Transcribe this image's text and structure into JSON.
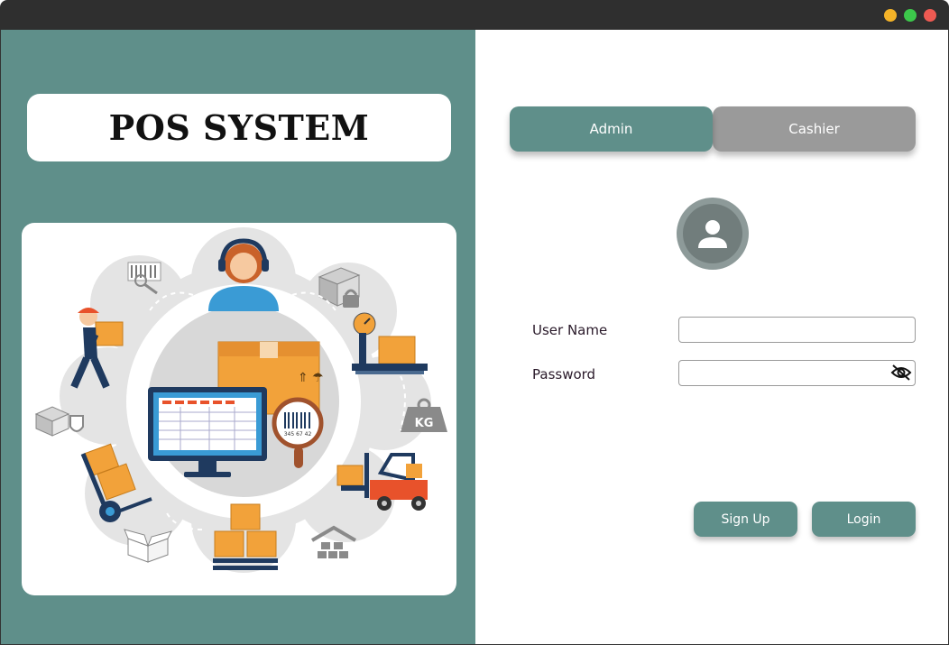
{
  "window": {
    "controls": [
      "minimize",
      "maximize",
      "close"
    ],
    "colors": {
      "minimize": "#f4b328",
      "maximize": "#3cc84b",
      "close": "#ee5a52"
    }
  },
  "left_panel": {
    "title": "POS SYSTEM",
    "illustration": {
      "icons": [
        "agent-headset",
        "barcode-scan",
        "locked-box",
        "weighing-scale",
        "weight-kg",
        "forklift",
        "warehouse",
        "pallet-boxes",
        "open-box",
        "hand-truck",
        "shield-box",
        "delivery-worker",
        "pos-monitor",
        "barcode-magnifier"
      ],
      "barcode_text": "345 67 42",
      "weight_label": "KG"
    }
  },
  "right_panel": {
    "tabs": [
      {
        "label": "Admin",
        "active": true
      },
      {
        "label": "Cashier",
        "active": false
      }
    ],
    "avatar_icon": "user-icon",
    "form": {
      "username_label": "User Name",
      "username_value": "",
      "password_label": "Password",
      "password_value": "",
      "password_toggle_icon": "eye-slash-icon"
    },
    "buttons": {
      "signup_label": "Sign Up",
      "login_label": "Login"
    }
  },
  "colors": {
    "accent": "#5f8f8a",
    "inactive_tab": "#9a9a9a",
    "orange": "#f2a23a",
    "navy": "#1f3a5f"
  }
}
